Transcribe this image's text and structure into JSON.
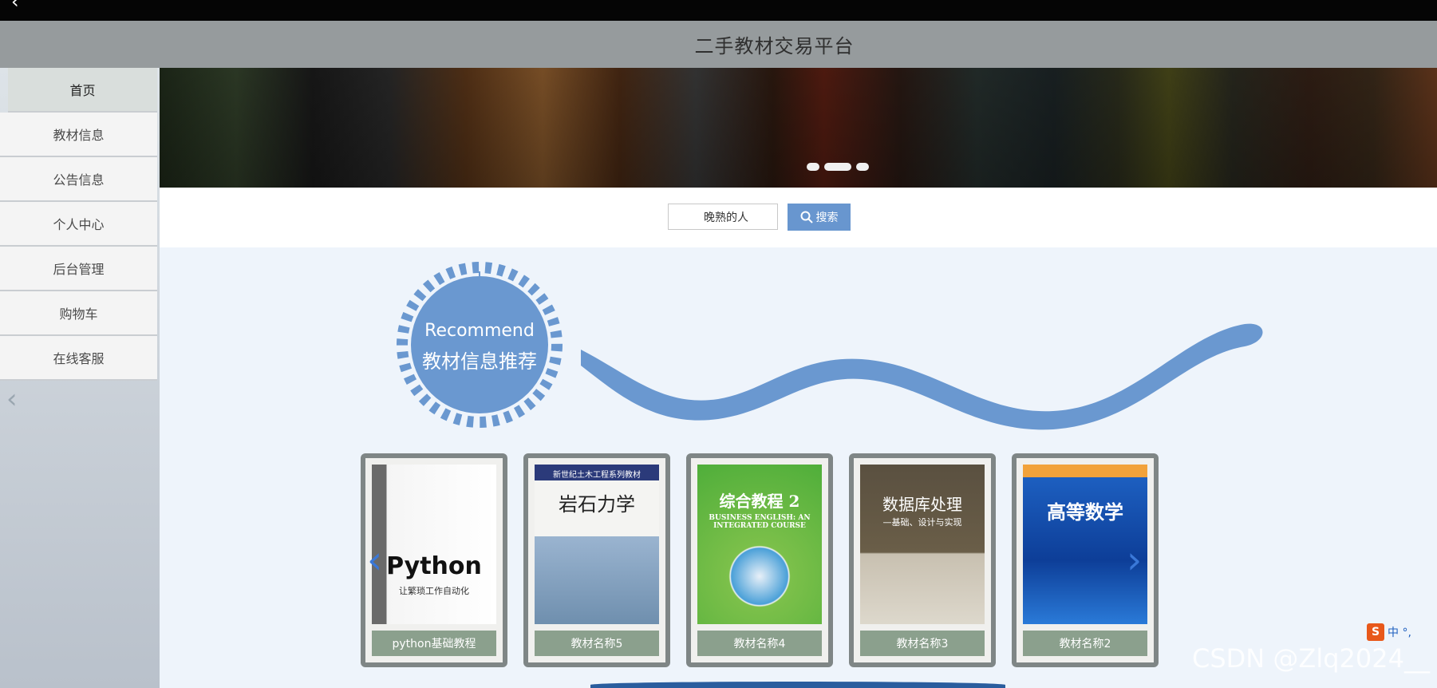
{
  "app": {
    "title": "二手教材交易平台",
    "back_icon": "back-arrow-icon"
  },
  "sidebar": {
    "items": [
      {
        "label": "首页",
        "active": true
      },
      {
        "label": "教材信息"
      },
      {
        "label": "公告信息"
      },
      {
        "label": "个人中心"
      },
      {
        "label": "后台管理"
      },
      {
        "label": "购物车"
      },
      {
        "label": "在线客服"
      }
    ],
    "collapse_icon": "chevron-left-icon"
  },
  "banner": {
    "dots": 3,
    "active_dot": 2
  },
  "search": {
    "value": "晚熟的人",
    "button_label": "搜索",
    "icon": "search-icon"
  },
  "recommend": {
    "en": "Recommend",
    "cn": "教材信息推荐"
  },
  "books": [
    {
      "caption": "python基础教程",
      "cover_title": "Python",
      "cover_sub": "让繁琐工作自动化"
    },
    {
      "caption": "教材名称5",
      "cover_title": "岩石力学",
      "cover_sub": "新世纪土木工程系列教材"
    },
    {
      "caption": "教材名称4",
      "cover_title": "综合教程 2",
      "cover_sub": "BUSINESS ENGLISH: AN INTEGRATED COURSE"
    },
    {
      "caption": "教材名称3",
      "cover_title": "数据库处理",
      "cover_sub": "—基础、设计与实现"
    },
    {
      "caption": "教材名称2",
      "cover_title": "高等数学",
      "cover_sub": ""
    }
  ],
  "ime": {
    "logo": "S",
    "text": "中 °,"
  },
  "watermark": "CSDN @Zlq2024__",
  "colors": {
    "accent": "#6896cf",
    "header": "#969b9d",
    "caption": "#8ba08d"
  }
}
